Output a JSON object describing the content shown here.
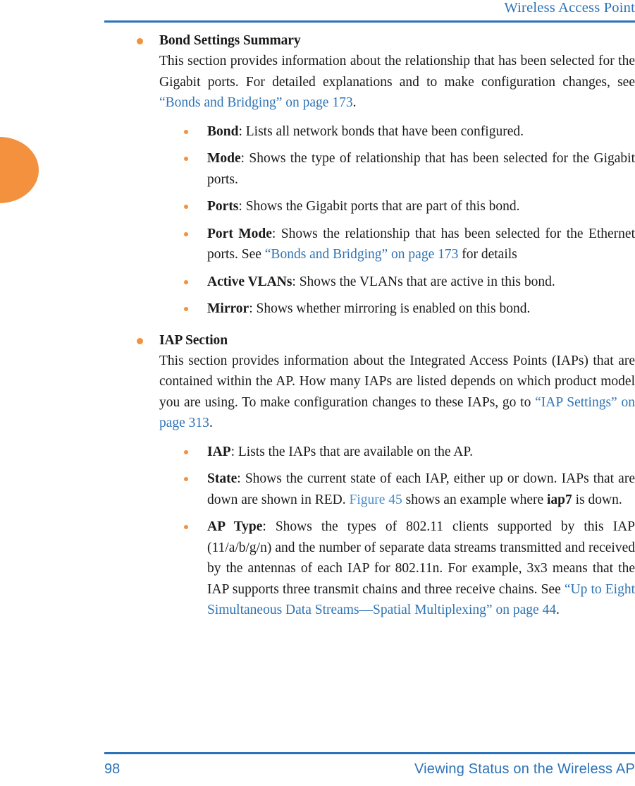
{
  "header": {
    "title": "Wireless Access Point"
  },
  "footer": {
    "page_number": "98",
    "section_title": "Viewing Status on the Wireless AP"
  },
  "colors": {
    "accent_blue": "#2B72B8",
    "link_blue": "#2E74B5",
    "link_blue_light": "#4A8CC9",
    "bullet_orange": "#F3913E",
    "body_text": "#1a1a1a"
  },
  "sections": [
    {
      "heading": "Bond Settings Summary",
      "paragraph": {
        "before": "This section provides information about the relationship that has been selected for the Gigabit ports. For detailed explanations and to make configuration changes, see ",
        "link": "“Bonds and Bridging” on page 173",
        "after": "."
      },
      "items": [
        {
          "term": "Bond",
          "text": ": Lists all network bonds that have been configured."
        },
        {
          "term": "Mode",
          "text": ": Shows the type of relationship that has been selected for the Gigabit ports."
        },
        {
          "term": "Ports",
          "text": ": Shows the Gigabit ports that are part of this bond."
        },
        {
          "term": "Port Mode",
          "text": ": Shows the relationship that has been selected for the Ethernet ports. See ",
          "link": "“Bonds and Bridging” on page 173",
          "text_after": " for details"
        },
        {
          "term": "Active VLANs",
          "text": ": Shows the VLANs that are active in this bond."
        },
        {
          "term": "Mirror",
          "text": ": Shows whether mirroring is enabled on this bond."
        }
      ]
    },
    {
      "heading": "IAP Section",
      "paragraph": {
        "before": "This section provides information about the Integrated Access Points (IAPs) that are contained within the AP. How many IAPs are listed depends on which product model you are using. To make configuration changes to these IAPs, go to ",
        "link": "“IAP Settings” on page 313",
        "after": "."
      },
      "items": [
        {
          "term": "IAP",
          "text": ": Lists the IAPs that are available on the AP."
        },
        {
          "term": "State",
          "text": ": Shows the current state of each IAP, either up or down. IAPs that are down are shown in RED. ",
          "link": "Figure 45",
          "text_after": " shows an example where ",
          "emphasis": "iap7",
          "text_end": " is down."
        },
        {
          "term": "AP Type",
          "text": ": Shows the types of 802.11 clients supported by this IAP (11/a/b/g/n) and the number of separate data streams transmitted and received by the antennas of each IAP for 802.11n. For example, 3x3 means that the IAP supports three transmit chains and three receive chains. See ",
          "link": "“Up to Eight Simultaneous Data Streams—Spatial Multiplexing” on page 44",
          "text_after": "."
        }
      ]
    }
  ]
}
